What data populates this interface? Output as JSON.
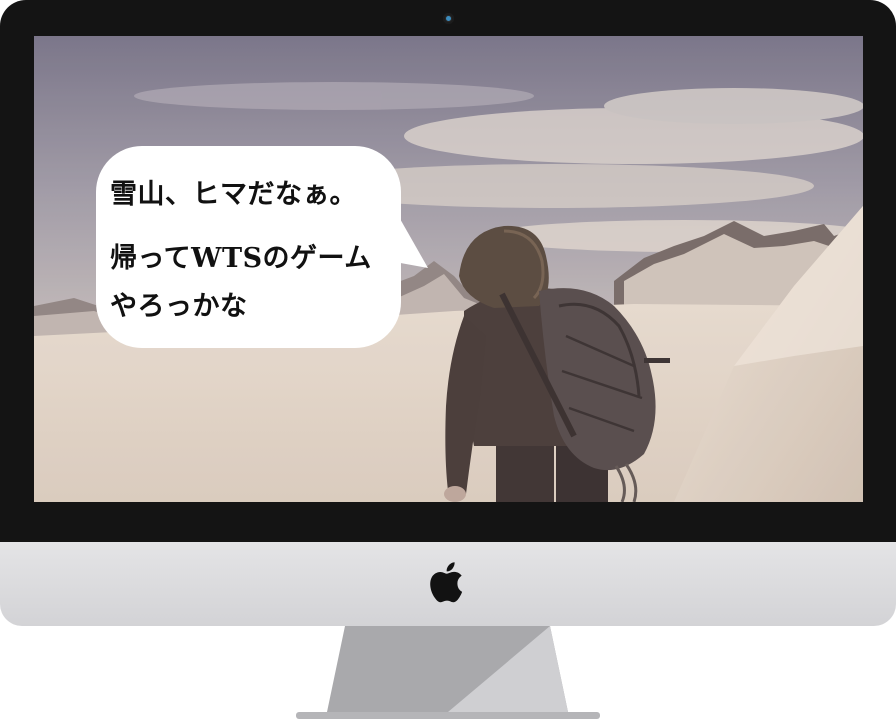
{
  "device": {
    "type": "imac",
    "camera_icon": "webcam-icon",
    "logo_icon": "apple-logo-icon",
    "bezel_color": "#141414",
    "chin_color": "#dcdcdf"
  },
  "screen": {
    "scene": "hiker-in-snowy-mountains",
    "speech_bubble": {
      "lines": [
        "雪山、ヒマだなぁ。",
        "帰ってWTSのゲーム",
        "やろっかな"
      ]
    }
  }
}
